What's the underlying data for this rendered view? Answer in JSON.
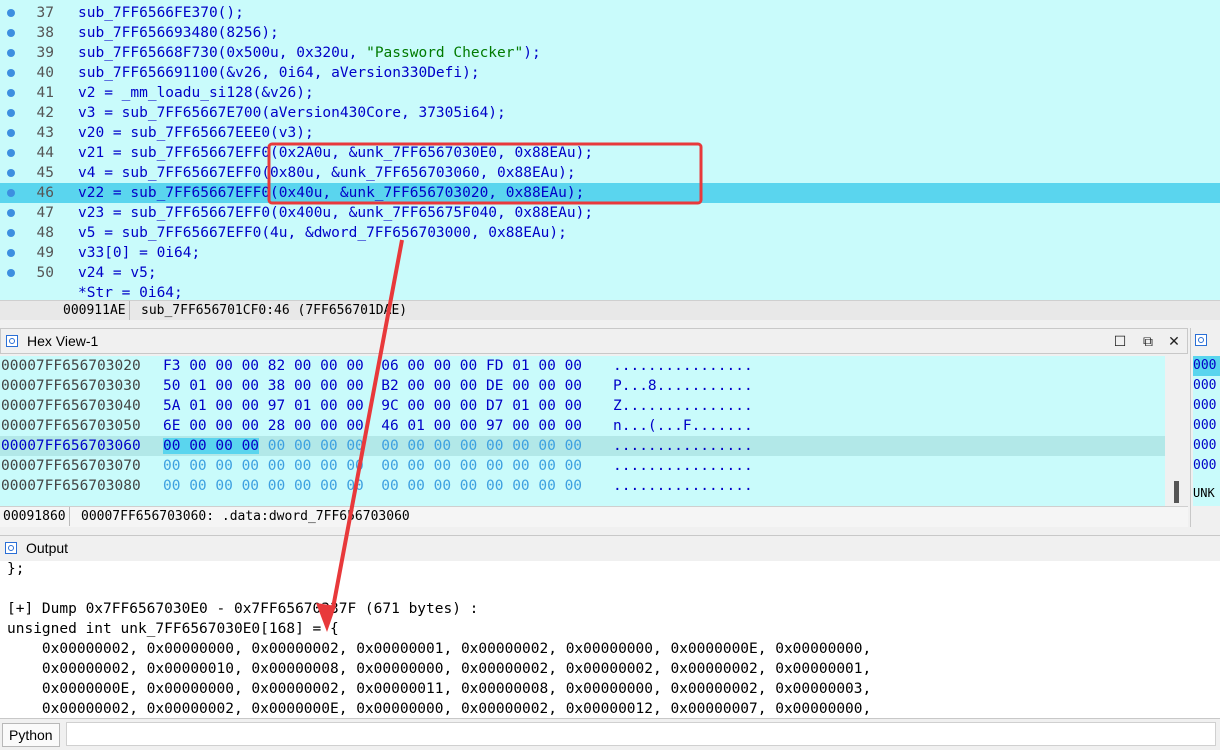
{
  "pseudocode": {
    "lines": [
      {
        "num": "37",
        "code": "sub_7FF6566FE370();"
      },
      {
        "num": "38",
        "code": "sub_7FF656693480(8256);"
      },
      {
        "num": "39",
        "code": "sub_7FF65668F730(0x500u, 0x320u, ",
        "str": "\"Password Checker\"",
        "tail": ");"
      },
      {
        "num": "40",
        "code": "sub_7FF656691100(&v26, 0i64, aVersion330Defi);"
      },
      {
        "num": "41",
        "code": "v2 = _mm_loadu_si128(&v26);"
      },
      {
        "num": "42",
        "code": "v3 = sub_7FF65667E700(aVersion430Core, 37305i64);"
      },
      {
        "num": "43",
        "code": "v20 = sub_7FF65667EEE0(v3);"
      },
      {
        "num": "44",
        "code": "v21 = sub_7FF65667EFF0(0x2A0u, &unk_7FF6567030E0, 0x88EAu);"
      },
      {
        "num": "45",
        "code": "v4 = sub_7FF65667EFF0(0x80u, &unk_7FF656703060, 0x88EAu);"
      },
      {
        "num": "46",
        "code": "v22 = sub_7FF65667EFF0(0x40u, &unk_7FF656703020, 0x88EAu);"
      },
      {
        "num": "47",
        "code": "v23 = sub_7FF65667EFF0(0x400u, &unk_7FF65675F040, 0x88EAu);"
      },
      {
        "num": "48",
        "code": "v5 = sub_7FF65667EFF0(4u, &dword_7FF656703000, 0x88EAu);"
      },
      {
        "num": "49",
        "code": "v33[0] = 0i64;"
      },
      {
        "num": "50",
        "code": "v24 = v5;"
      },
      {
        "num": "",
        "code": "*Str = 0i64;"
      }
    ],
    "status_offset": "000911AE",
    "status_func": "sub_7FF656701CF0:46 (7FF656701DAE)"
  },
  "hexview": {
    "title": "Hex View-1",
    "rows": [
      {
        "addr": "00007FF656703020",
        "bytes": "F3 00 00 00 82 00 00 00  06 00 00 00 FD 01 00 00",
        "ascii": "................"
      },
      {
        "addr": "00007FF656703030",
        "bytes": "50 01 00 00 38 00 00 00  B2 00 00 00 DE 00 00 00",
        "ascii": "P...8..........."
      },
      {
        "addr": "00007FF656703040",
        "bytes": "5A 01 00 00 97 01 00 00  9C 00 00 00 D7 01 00 00",
        "ascii": "Z..............."
      },
      {
        "addr": "00007FF656703050",
        "bytes": "6E 00 00 00 28 00 00 00  46 01 00 00 97 00 00 00",
        "ascii": "n...(...F......."
      },
      {
        "addr": "00007FF656703060",
        "sel": "00 00 00 00",
        "bytes": " 00 00 00 00  00 00 00 00 00 00 00 00",
        "ascii": "................"
      },
      {
        "addr": "00007FF656703070",
        "bytes": "00 00 00 00 00 00 00 00  00 00 00 00 00 00 00 00",
        "ascii": "................"
      },
      {
        "addr": "00007FF656703080",
        "bytes": "00 00 00 00 00 00 00 00  00 00 00 00 00 00 00 00",
        "ascii": "................"
      }
    ],
    "status_offset": "00091860",
    "status_location": "00007FF656703060: .data:dword_7FF656703060"
  },
  "rightpane": {
    "rows": [
      "000",
      "000",
      "000",
      "000",
      "000",
      "000"
    ],
    "footer": "UNK"
  },
  "output": {
    "title": "Output",
    "lines": [
      "};",
      "",
      "[+] Dump 0x7FF6567030E0 - 0x7FF65670337F (671 bytes) :",
      "unsigned int unk_7FF6567030E0[168] = {",
      "    0x00000002, 0x00000000, 0x00000002, 0x00000001, 0x00000002, 0x00000000, 0x0000000E, 0x00000000,",
      "    0x00000002, 0x00000010, 0x00000008, 0x00000000, 0x00000002, 0x00000002, 0x00000002, 0x00000001,",
      "    0x0000000E, 0x00000000, 0x00000002, 0x00000011, 0x00000008, 0x00000000, 0x00000002, 0x00000003,",
      "    0x00000002, 0x00000002, 0x0000000E, 0x00000000, 0x00000002, 0x00000012, 0x00000007, 0x00000000,"
    ]
  },
  "python": {
    "button_label": "Python",
    "input_value": ""
  },
  "colors": {
    "pane_bg": "#c9fbfb",
    "highlight": "#5ad5ee",
    "annotation": "#e8393b"
  }
}
